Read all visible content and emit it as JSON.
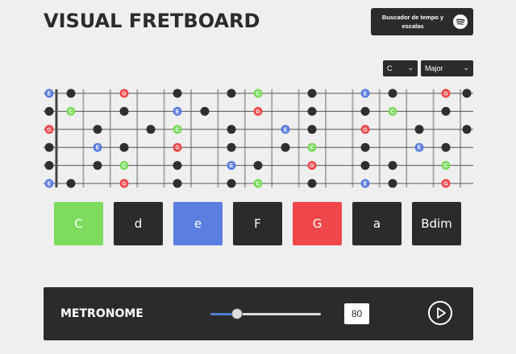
{
  "header": {
    "title": "VISUAL FRETBOARD",
    "spotify_button_label": "Buscador de tempo y escalas",
    "spotify_icon": "spotify-icon"
  },
  "controls": {
    "key_select": {
      "value": "C",
      "icon": "chevron-down-icon"
    },
    "scale_select": {
      "value": "Major",
      "icon": "chevron-down-icon"
    }
  },
  "colors": {
    "background": "#efefef",
    "panel": "#2b2b2b",
    "root": "#7ddb5e",
    "third": "#5b7fe0",
    "fifth": "#f0474a",
    "dot": "#2f2f2f",
    "string": "#555555",
    "fret": "#aaaaaa"
  },
  "fretboard": {
    "strings": 6,
    "frets": 15,
    "markers": [
      [
        [
          "E",
          "third"
        ],
        [
          "dot"
        ],
        [
          "dot"
        ],
        [
          "G",
          "fifth"
        ],
        [
          "dot"
        ],
        [
          "dot"
        ],
        [
          "dot"
        ],
        [
          "C",
          "root"
        ],
        [
          "dot"
        ],
        [
          "dot"
        ],
        [
          "E",
          "third"
        ],
        [
          "dot"
        ],
        [
          "dot"
        ],
        [
          "G",
          "fifth"
        ],
        [
          "dot"
        ]
      ],
      [
        [
          "dot"
        ],
        [
          "C",
          "root"
        ],
        [
          "dot"
        ],
        [
          "dot"
        ],
        [
          "E",
          "third"
        ],
        [
          "dot"
        ],
        [
          "dot"
        ],
        [
          "G",
          "fifth"
        ],
        [
          "dot"
        ],
        [
          "dot"
        ],
        [
          "dot"
        ],
        [
          "C",
          "root"
        ],
        [
          "dot"
        ],
        [
          "dot"
        ],
        [
          "dot"
        ]
      ],
      [
        [
          "G",
          "fifth"
        ],
        [
          "dot"
        ],
        [
          "dot"
        ],
        [
          "dot"
        ],
        [
          "C",
          "root"
        ],
        [
          "dot"
        ],
        [
          "E",
          "third"
        ],
        [
          "dot"
        ],
        [
          "G",
          "fifth"
        ],
        [
          "dot"
        ],
        [
          "dot"
        ],
        [
          "dot"
        ],
        [
          "dot"
        ],
        [
          "dot"
        ],
        [
          "dot"
        ]
      ],
      [
        [
          "dot"
        ],
        [
          "dot"
        ],
        [
          "E",
          "third"
        ],
        [
          "dot"
        ],
        [
          "G",
          "fifth"
        ],
        [
          "dot"
        ],
        [
          "dot"
        ],
        [
          "C",
          "root"
        ],
        [
          "dot"
        ],
        [
          "dot"
        ],
        [
          "E",
          "third"
        ],
        [
          "dot"
        ],
        [
          "dot"
        ],
        [
          "dot"
        ],
        [
          "dot"
        ]
      ],
      [
        [
          "dot"
        ],
        [
          "dot"
        ],
        [
          "C",
          "root"
        ],
        [
          "dot"
        ],
        [
          "dot"
        ],
        [
          "E",
          "third"
        ],
        [
          "dot"
        ],
        [
          "G",
          "fifth"
        ],
        [
          "dot"
        ],
        [
          "dot"
        ],
        [
          "dot"
        ],
        [
          "C",
          "root"
        ],
        [
          "dot"
        ],
        [
          "dot"
        ],
        [
          "dot"
        ]
      ],
      [
        [
          "E",
          "third"
        ],
        [
          "dot"
        ],
        [
          "dot"
        ],
        [
          "G",
          "fifth"
        ],
        [
          "dot"
        ],
        [
          "dot"
        ],
        [
          "dot"
        ],
        [
          "C",
          "root"
        ],
        [
          "dot"
        ],
        [
          "dot"
        ],
        [
          "E",
          "third"
        ],
        [
          "dot"
        ],
        [
          "dot"
        ],
        [
          "G",
          "fifth"
        ],
        [
          "dot"
        ]
      ]
    ]
  },
  "chords": [
    {
      "label": "C",
      "color": "#7ddb5e"
    },
    {
      "label": "d",
      "color": "#2b2b2b"
    },
    {
      "label": "e",
      "color": "#5b7fe0"
    },
    {
      "label": "F",
      "color": "#2b2b2b"
    },
    {
      "label": "G",
      "color": "#f0474a"
    },
    {
      "label": "a",
      "color": "#2b2b2b"
    },
    {
      "label": "Bdim",
      "color": "#2b2b2b"
    }
  ],
  "metronome": {
    "label": "METRONOME",
    "bpm": "80",
    "slider_fraction": 0.24,
    "play_icon": "play-icon"
  }
}
